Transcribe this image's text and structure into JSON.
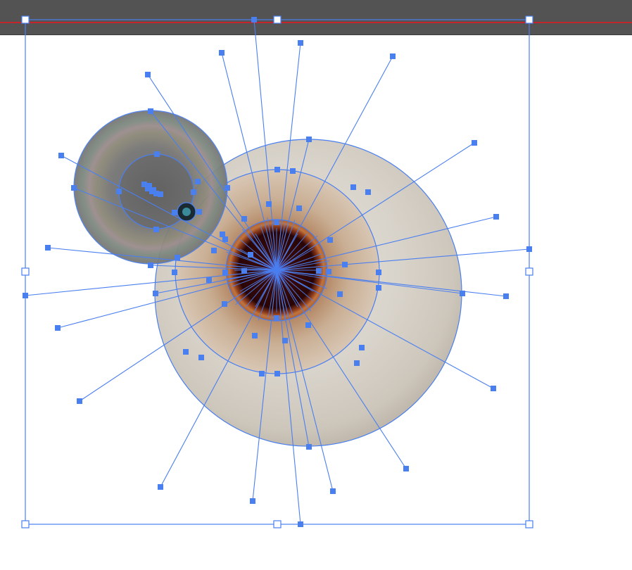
{
  "colors": {
    "toolbar_bg": "#535353",
    "guide_red": "#c4242c",
    "selection_blue": "#4a7ff0",
    "handle_fill_blue": "#4a7ff0",
    "handle_fill_white": "#ffffff",
    "sclera_light": "#dcd8cf",
    "sclera_edge": "#bdb6aa",
    "iris_outer": "#c8ab8c",
    "iris_inner": "#a7764f",
    "pupil": "#2b0606",
    "lens_gray": "#7a7a7a",
    "lens_ring": "#9b8f80"
  },
  "artwork": {
    "type": "vector-eyeball-with-gradient-mesh-selection",
    "objects": [
      "eyeball",
      "iris",
      "pupil",
      "lens-flare-overlay"
    ],
    "selection_state": "selected",
    "tool": "direct-selection"
  }
}
